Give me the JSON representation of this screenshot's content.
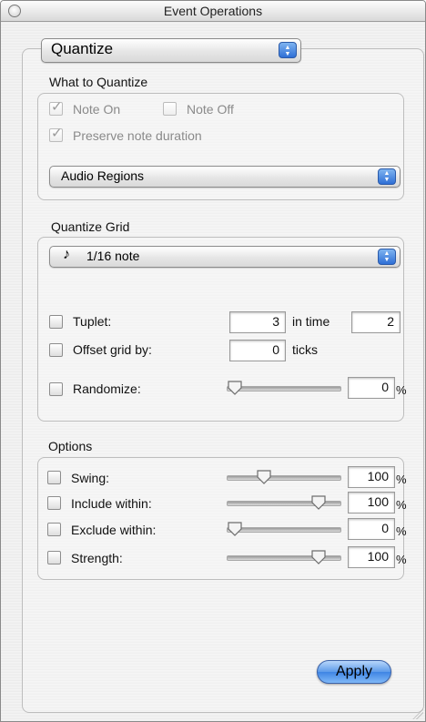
{
  "window": {
    "title": "Event Operations"
  },
  "operation_menu": {
    "value": "Quantize"
  },
  "what_to_quantize": {
    "title": "What to Quantize",
    "note_on": {
      "label": "Note On",
      "checked": true
    },
    "note_off": {
      "label": "Note Off",
      "checked": false
    },
    "preserve": {
      "label": "Preserve note duration",
      "checked": true
    },
    "source_menu": {
      "value": "Audio Regions"
    }
  },
  "quantize_grid": {
    "title": "Quantize Grid",
    "grid_menu": {
      "icon": "eighth-note-icon",
      "glyph": "♪",
      "value": "1/16 note"
    },
    "tuplet": {
      "label": "Tuplet:",
      "value1": "3",
      "in_time_label": "in time",
      "value2": "2"
    },
    "offset": {
      "label": "Offset grid by:",
      "value": "0",
      "unit": "ticks"
    },
    "randomize": {
      "label": "Randomize:",
      "value": "0",
      "unit": "%",
      "level": 0
    }
  },
  "options": {
    "title": "Options",
    "swing": {
      "label": "Swing:",
      "value": "100",
      "unit": "%",
      "level": 0.3
    },
    "include": {
      "label": "Include within:",
      "value": "100",
      "unit": "%",
      "level": 0.85
    },
    "exclude": {
      "label": "Exclude within:",
      "value": "0",
      "unit": "%",
      "level": 0
    },
    "strength": {
      "label": "Strength:",
      "value": "100",
      "unit": "%",
      "level": 0.85
    }
  },
  "apply_button": {
    "label": "Apply"
  }
}
